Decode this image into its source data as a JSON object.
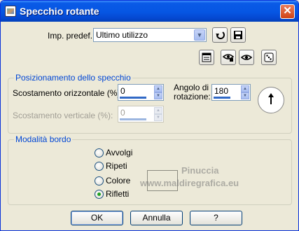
{
  "window": {
    "title": "Specchio rotante",
    "close_symbol": "✕"
  },
  "preset": {
    "label": "Imp. predef.:",
    "value": "Ultimo utilizzo"
  },
  "mirror_section": {
    "title": "Posizionamento dello specchio",
    "horizontal_label": "Scostamento orizzontale (%):",
    "horizontal_value": "0",
    "vertical_label": "Scostamento verticale (%):",
    "vertical_value": "0",
    "angle_label_line1": "Angolo di",
    "angle_label_line2": "rotazione:",
    "angle_value": "180"
  },
  "border_section": {
    "title": "Modalità bordo",
    "options": [
      {
        "label": "Avvolgi",
        "checked": false
      },
      {
        "label": "Ripeti",
        "checked": false
      },
      {
        "label": "Colore",
        "checked": false
      },
      {
        "label": "Rifletti",
        "checked": true
      }
    ]
  },
  "watermark": {
    "line1": "Pinuccia",
    "line2": "www.maldiregrafica.eu"
  },
  "buttons": {
    "ok": "OK",
    "cancel": "Annulla",
    "help": "?"
  }
}
